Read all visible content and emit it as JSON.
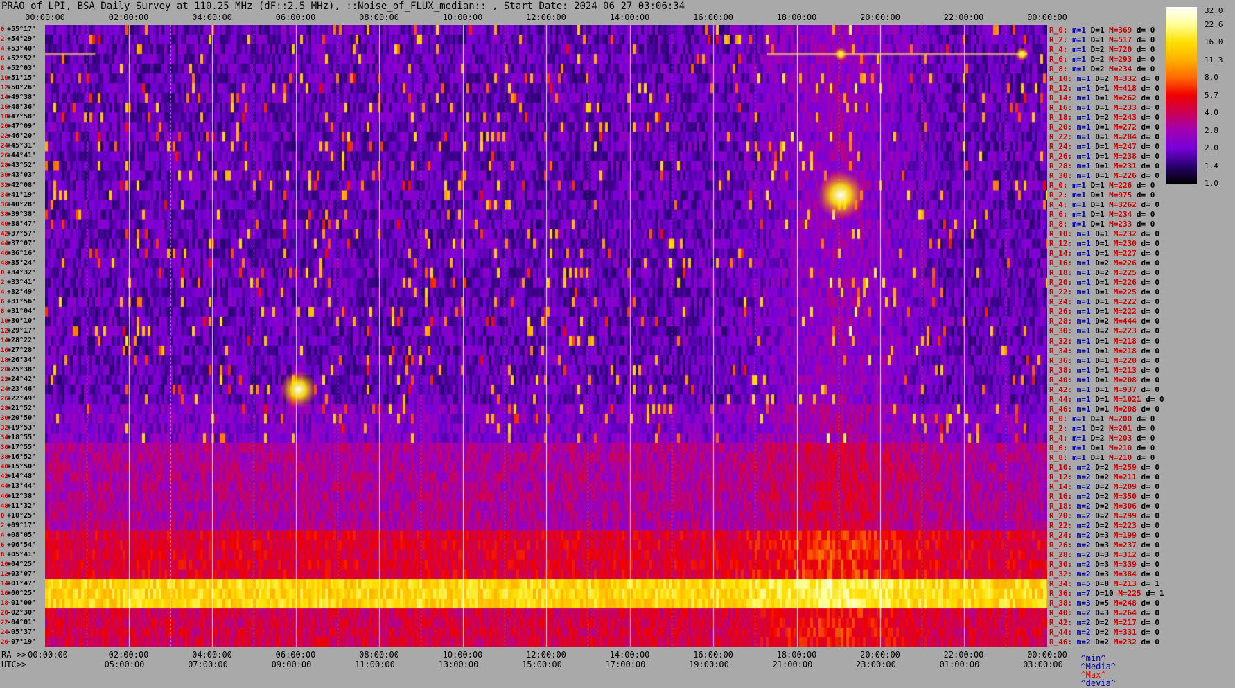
{
  "title": "PRAO of LPI, BSA Daily Survey at 110.25 MHz (dF::2.5 MHz), ::Noise_of_FLUX_median:: , Start Date: 2024 06 27 03:06:34",
  "axes": {
    "ra_label": "RA >>",
    "utc_label": "UTC>>",
    "ra_ticks": [
      "00:00:00",
      "02:00:00",
      "04:00:00",
      "06:00:00",
      "08:00:00",
      "10:00:00",
      "12:00:00",
      "14:00:00",
      "16:00:00",
      "18:00:00",
      "20:00:00",
      "22:00:00",
      "00:00:00"
    ],
    "utc_ticks": [
      "05:00:00",
      "07:00:00",
      "09:00:00",
      "11:00:00",
      "13:00:00",
      "15:00:00",
      "17:00:00",
      "19:00:00",
      "21:00:00",
      "23:00:00",
      "01:00:00",
      "03:00:00"
    ],
    "bottom_ra_first": "00:00:00"
  },
  "chart_data": {
    "type": "heatmap",
    "title": "PRAO of LPI, BSA Daily Survey at 110.25 MHz (dF::2.5 MHz), ::Noise_of_FLUX_median:: , Start Date: 2024 06 27 03:06:34",
    "x_axis": "RA / UTC",
    "y_axis": "Declination",
    "declinations": [
      "+55°17'",
      "+54°29'",
      "+53°40'",
      "+52°52'",
      "+52°03'",
      "+51°15'",
      "+50°26'",
      "+49°38'",
      "+48°36'",
      "+47°58'",
      "+47°09'",
      "+46°20'",
      "+45°31'",
      "+44°41'",
      "+43°52'",
      "+43°03'",
      "+42°08'",
      "+41°19'",
      "+40°28'",
      "+39°38'",
      "+38°47'",
      "+37°57'",
      "+37°07'",
      "+36°16'",
      "+35°24'",
      "+34°32'",
      "+33°41'",
      "+32°49'",
      "+31°56'",
      "+31°04'",
      "+30°10'",
      "+29°17'",
      "+28°22'",
      "+27°28'",
      "+26°34'",
      "+25°38'",
      "+24°42'",
      "+23°46'",
      "+22°49'",
      "+21°52'",
      "+20°50'",
      "+19°53'",
      "+18°55'",
      "+17°55'",
      "+16°52'",
      "+15°50'",
      "+14°48'",
      "+13°44'",
      "+12°38'",
      "+11°32'",
      "+10°25'",
      "+09°17'",
      "+08°05'",
      "+06°54'",
      "+05°41'",
      "+04°25'",
      "+03°07'",
      "+01°47'",
      "+00°25'",
      "-01°00'",
      "-02°30'",
      "-04°01'",
      "-05°37'",
      "-07°19'"
    ],
    "row_indices": [
      "0",
      "2",
      "4",
      "6",
      "8",
      "10",
      "12",
      "14",
      "16",
      "18",
      "20",
      "22",
      "24",
      "26",
      "28",
      "30",
      "32",
      "34",
      "36",
      "38",
      "40",
      "42",
      "44",
      "46",
      "48",
      "0",
      "2",
      "4",
      "6",
      "8",
      "10",
      "12",
      "14",
      "16",
      "18",
      "20",
      "22",
      "24",
      "26",
      "28",
      "30",
      "32",
      "34",
      "36",
      "38",
      "40",
      "42",
      "44",
      "46",
      "48",
      "0",
      "2",
      "4",
      "6",
      "8",
      "10",
      "12",
      "14",
      "16",
      "18",
      "20",
      "22",
      "24",
      "26"
    ],
    "colorbar": {
      "values": [
        "32.0",
        "22.6",
        "16.0",
        "11.3",
        "8.0",
        "5.7",
        "4.0",
        "2.8",
        "2.0",
        "1.4",
        "1.0"
      ],
      "colors": [
        "#ffffff",
        "#ffff99",
        "#ffe000",
        "#ffb000",
        "#ff6a00",
        "#ee0000",
        "#cc0055",
        "#a000b4",
        "#7800d8",
        "#2a0070",
        "#000000"
      ]
    },
    "beam_stats": [
      {
        "r": "R_0:",
        "m": "m=1",
        "D": "D=1",
        "M": "M=369",
        "d": "d= 0"
      },
      {
        "r": "R_2:",
        "m": "m=1",
        "D": "D=1",
        "M": "M=517",
        "d": "d= 0"
      },
      {
        "r": "R_4:",
        "m": "m=1",
        "D": "D=2",
        "M": "M=720",
        "d": "d= 0"
      },
      {
        "r": "R_6:",
        "m": "m=1",
        "D": "D=2",
        "M": "M=293",
        "d": "d= 0"
      },
      {
        "r": "R_8:",
        "m": "m=1",
        "D": "D=2",
        "M": "M=234",
        "d": "d= 0"
      },
      {
        "r": "R_10:",
        "m": "m=1",
        "D": "D=2",
        "M": "M=332",
        "d": "d= 0"
      },
      {
        "r": "R_12:",
        "m": "m=1",
        "D": "D=1",
        "M": "M=418",
        "d": "d= 0"
      },
      {
        "r": "R_14:",
        "m": "m=1",
        "D": "D=1",
        "M": "M=262",
        "d": "d= 0"
      },
      {
        "r": "R_16:",
        "m": "m=1",
        "D": "D=1",
        "M": "M=233",
        "d": "d= 0"
      },
      {
        "r": "R_18:",
        "m": "m=1",
        "D": "D=2",
        "M": "M=243",
        "d": "d= 0"
      },
      {
        "r": "R_20:",
        "m": "m=1",
        "D": "D=1",
        "M": "M=272",
        "d": "d= 0"
      },
      {
        "r": "R_22:",
        "m": "m=1",
        "D": "D=1",
        "M": "M=284",
        "d": "d= 0"
      },
      {
        "r": "R_24:",
        "m": "m=1",
        "D": "D=1",
        "M": "M=247",
        "d": "d= 0"
      },
      {
        "r": "R_26:",
        "m": "m=1",
        "D": "D=1",
        "M": "M=238",
        "d": "d= 0"
      },
      {
        "r": "R_28:",
        "m": "m=1",
        "D": "D=1",
        "M": "M=231",
        "d": "d= 0"
      },
      {
        "r": "R_30:",
        "m": "m=1",
        "D": "D=1",
        "M": "M=226",
        "d": "d= 0"
      },
      {
        "r": "R_0:",
        "m": "m=1",
        "D": "D=1",
        "M": "M=226",
        "d": "d= 0"
      },
      {
        "r": "R_2:",
        "m": "m=1",
        "D": "D=1",
        "M": "M=975",
        "d": "d= 0"
      },
      {
        "r": "R_4:",
        "m": "m=1",
        "D": "D=1",
        "M": "M=3262",
        "d": "d= 0"
      },
      {
        "r": "R_6:",
        "m": "m=1",
        "D": "D=1",
        "M": "M=234",
        "d": "d= 0"
      },
      {
        "r": "R_8:",
        "m": "m=1",
        "D": "D=1",
        "M": "M=233",
        "d": "d= 0"
      },
      {
        "r": "R_10:",
        "m": "m=1",
        "D": "D=1",
        "M": "M=232",
        "d": "d= 0"
      },
      {
        "r": "R_12:",
        "m": "m=1",
        "D": "D=1",
        "M": "M=230",
        "d": "d= 0"
      },
      {
        "r": "R_14:",
        "m": "m=1",
        "D": "D=1",
        "M": "M=227",
        "d": "d= 0"
      },
      {
        "r": "R_16:",
        "m": "m=1",
        "D": "D=2",
        "M": "M=226",
        "d": "d= 0"
      },
      {
        "r": "R_18:",
        "m": "m=1",
        "D": "D=2",
        "M": "M=225",
        "d": "d= 0"
      },
      {
        "r": "R_20:",
        "m": "m=1",
        "D": "D=1",
        "M": "M=226",
        "d": "d= 0"
      },
      {
        "r": "R_22:",
        "m": "m=1",
        "D": "D=1",
        "M": "M=225",
        "d": "d= 0"
      },
      {
        "r": "R_24:",
        "m": "m=1",
        "D": "D=1",
        "M": "M=222",
        "d": "d= 0"
      },
      {
        "r": "R_26:",
        "m": "m=1",
        "D": "D=1",
        "M": "M=222",
        "d": "d= 0"
      },
      {
        "r": "R_28:",
        "m": "m=1",
        "D": "D=2",
        "M": "M=444",
        "d": "d= 0"
      },
      {
        "r": "R_30:",
        "m": "m=1",
        "D": "D=2",
        "M": "M=223",
        "d": "d= 0"
      },
      {
        "r": "R_32:",
        "m": "m=1",
        "D": "D=1",
        "M": "M=218",
        "d": "d= 0"
      },
      {
        "r": "R_34:",
        "m": "m=1",
        "D": "D=1",
        "M": "M=218",
        "d": "d= 0"
      },
      {
        "r": "R_36:",
        "m": "m=1",
        "D": "D=1",
        "M": "M=220",
        "d": "d= 0"
      },
      {
        "r": "R_38:",
        "m": "m=1",
        "D": "D=1",
        "M": "M=213",
        "d": "d= 0"
      },
      {
        "r": "R_40:",
        "m": "m=1",
        "D": "D=1",
        "M": "M=208",
        "d": "d= 0"
      },
      {
        "r": "R_42:",
        "m": "m=1",
        "D": "D=1",
        "M": "M=937",
        "d": "d= 0"
      },
      {
        "r": "R_44:",
        "m": "m=1",
        "D": "D=1",
        "M": "M=1021",
        "d": "d= 0"
      },
      {
        "r": "R_46:",
        "m": "m=1",
        "D": "D=1",
        "M": "M=208",
        "d": "d= 0"
      },
      {
        "r": "R_0:",
        "m": "m=1",
        "D": "D=1",
        "M": "M=200",
        "d": "d= 0"
      },
      {
        "r": "R_2:",
        "m": "m=1",
        "D": "D=2",
        "M": "M=201",
        "d": "d= 0"
      },
      {
        "r": "R_4:",
        "m": "m=1",
        "D": "D=2",
        "M": "M=203",
        "d": "d= 0"
      },
      {
        "r": "R_6:",
        "m": "m=1",
        "D": "D=1",
        "M": "M=210",
        "d": "d= 0"
      },
      {
        "r": "R_8:",
        "m": "m=1",
        "D": "D=1",
        "M": "M=210",
        "d": "d= 0"
      },
      {
        "r": "R_10:",
        "m": "m=2",
        "D": "D=2",
        "M": "M=259",
        "d": "d= 0"
      },
      {
        "r": "R_12:",
        "m": "m=2",
        "D": "D=2",
        "M": "M=211",
        "d": "d= 0"
      },
      {
        "r": "R_14:",
        "m": "m=2",
        "D": "D=2",
        "M": "M=209",
        "d": "d= 0"
      },
      {
        "r": "R_16:",
        "m": "m=2",
        "D": "D=2",
        "M": "M=350",
        "d": "d= 0"
      },
      {
        "r": "R_18:",
        "m": "m=2",
        "D": "D=2",
        "M": "M=306",
        "d": "d= 0"
      },
      {
        "r": "R_20:",
        "m": "m=2",
        "D": "D=2",
        "M": "M=299",
        "d": "d= 0"
      },
      {
        "r": "R_22:",
        "m": "m=2",
        "D": "D=2",
        "M": "M=223",
        "d": "d= 0"
      },
      {
        "r": "R_24:",
        "m": "m=2",
        "D": "D=3",
        "M": "M=199",
        "d": "d= 0"
      },
      {
        "r": "R_26:",
        "m": "m=2",
        "D": "D=3",
        "M": "M=237",
        "d": "d= 0"
      },
      {
        "r": "R_28:",
        "m": "m=2",
        "D": "D=3",
        "M": "M=312",
        "d": "d= 0"
      },
      {
        "r": "R_30:",
        "m": "m=2",
        "D": "D=3",
        "M": "M=339",
        "d": "d= 0"
      },
      {
        "r": "R_32:",
        "m": "m=2",
        "D": "D=3",
        "M": "M=384",
        "d": "d= 0"
      },
      {
        "r": "R_34:",
        "m": "m=5",
        "D": "D=8",
        "M": "M=213",
        "d": "d= 1"
      },
      {
        "r": "R_36:",
        "m": "m=7",
        "D": "D=10",
        "M": "M=225",
        "d": "d= 1"
      },
      {
        "r": "R_38:",
        "m": "m=3",
        "D": "D=5",
        "M": "M=248",
        "d": "d= 0"
      },
      {
        "r": "R_40:",
        "m": "m=2",
        "D": "D=3",
        "M": "M=264",
        "d": "d= 0"
      },
      {
        "r": "R_42:",
        "m": "m=2",
        "D": "D=2",
        "M": "M=217",
        "d": "d= 0"
      },
      {
        "r": "R_44:",
        "m": "m=2",
        "D": "D=2",
        "M": "M=331",
        "d": "d= 0"
      },
      {
        "r": "R_46:",
        "m": "m=2",
        "D": "D=2",
        "M": "M=232",
        "d": "d= 0"
      }
    ],
    "legend": {
      "min": "^min^",
      "median": "^Media^",
      "max": "^Max^",
      "devia": "^devia^"
    }
  }
}
